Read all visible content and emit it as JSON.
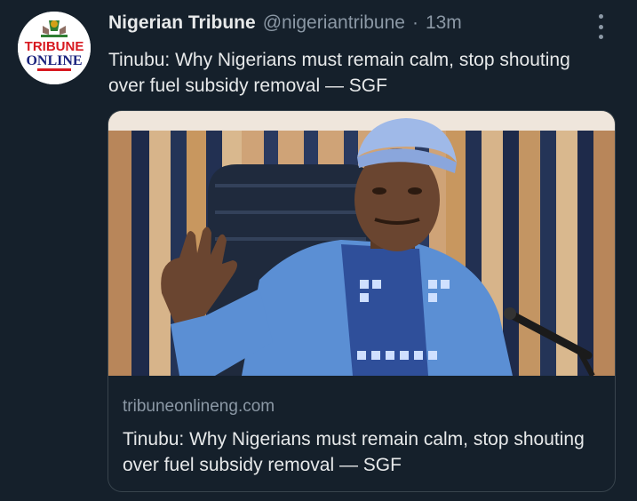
{
  "tweet": {
    "author_name": "Nigerian Tribune",
    "handle": "@nigeriantribune",
    "separator": "·",
    "time": "13m",
    "text": "Tinubu: Why Nigerians must remain calm, stop shouting over fuel subsidy removal — SGF",
    "avatar": {
      "line1": "TRIBUNE",
      "line2": "ONLINE"
    },
    "more_icon": "more-vertical-icon"
  },
  "link_card": {
    "domain": "tribuneonlineng.com",
    "title": "Tinubu: Why Nigerians must remain calm, stop shouting over fuel subsidy removal — SGF"
  },
  "colors": {
    "background": "#15202b",
    "primary_text": "#e7e9ea",
    "secondary_text": "#8b98a5",
    "border": "#38444d",
    "brand_red": "#d71920"
  }
}
